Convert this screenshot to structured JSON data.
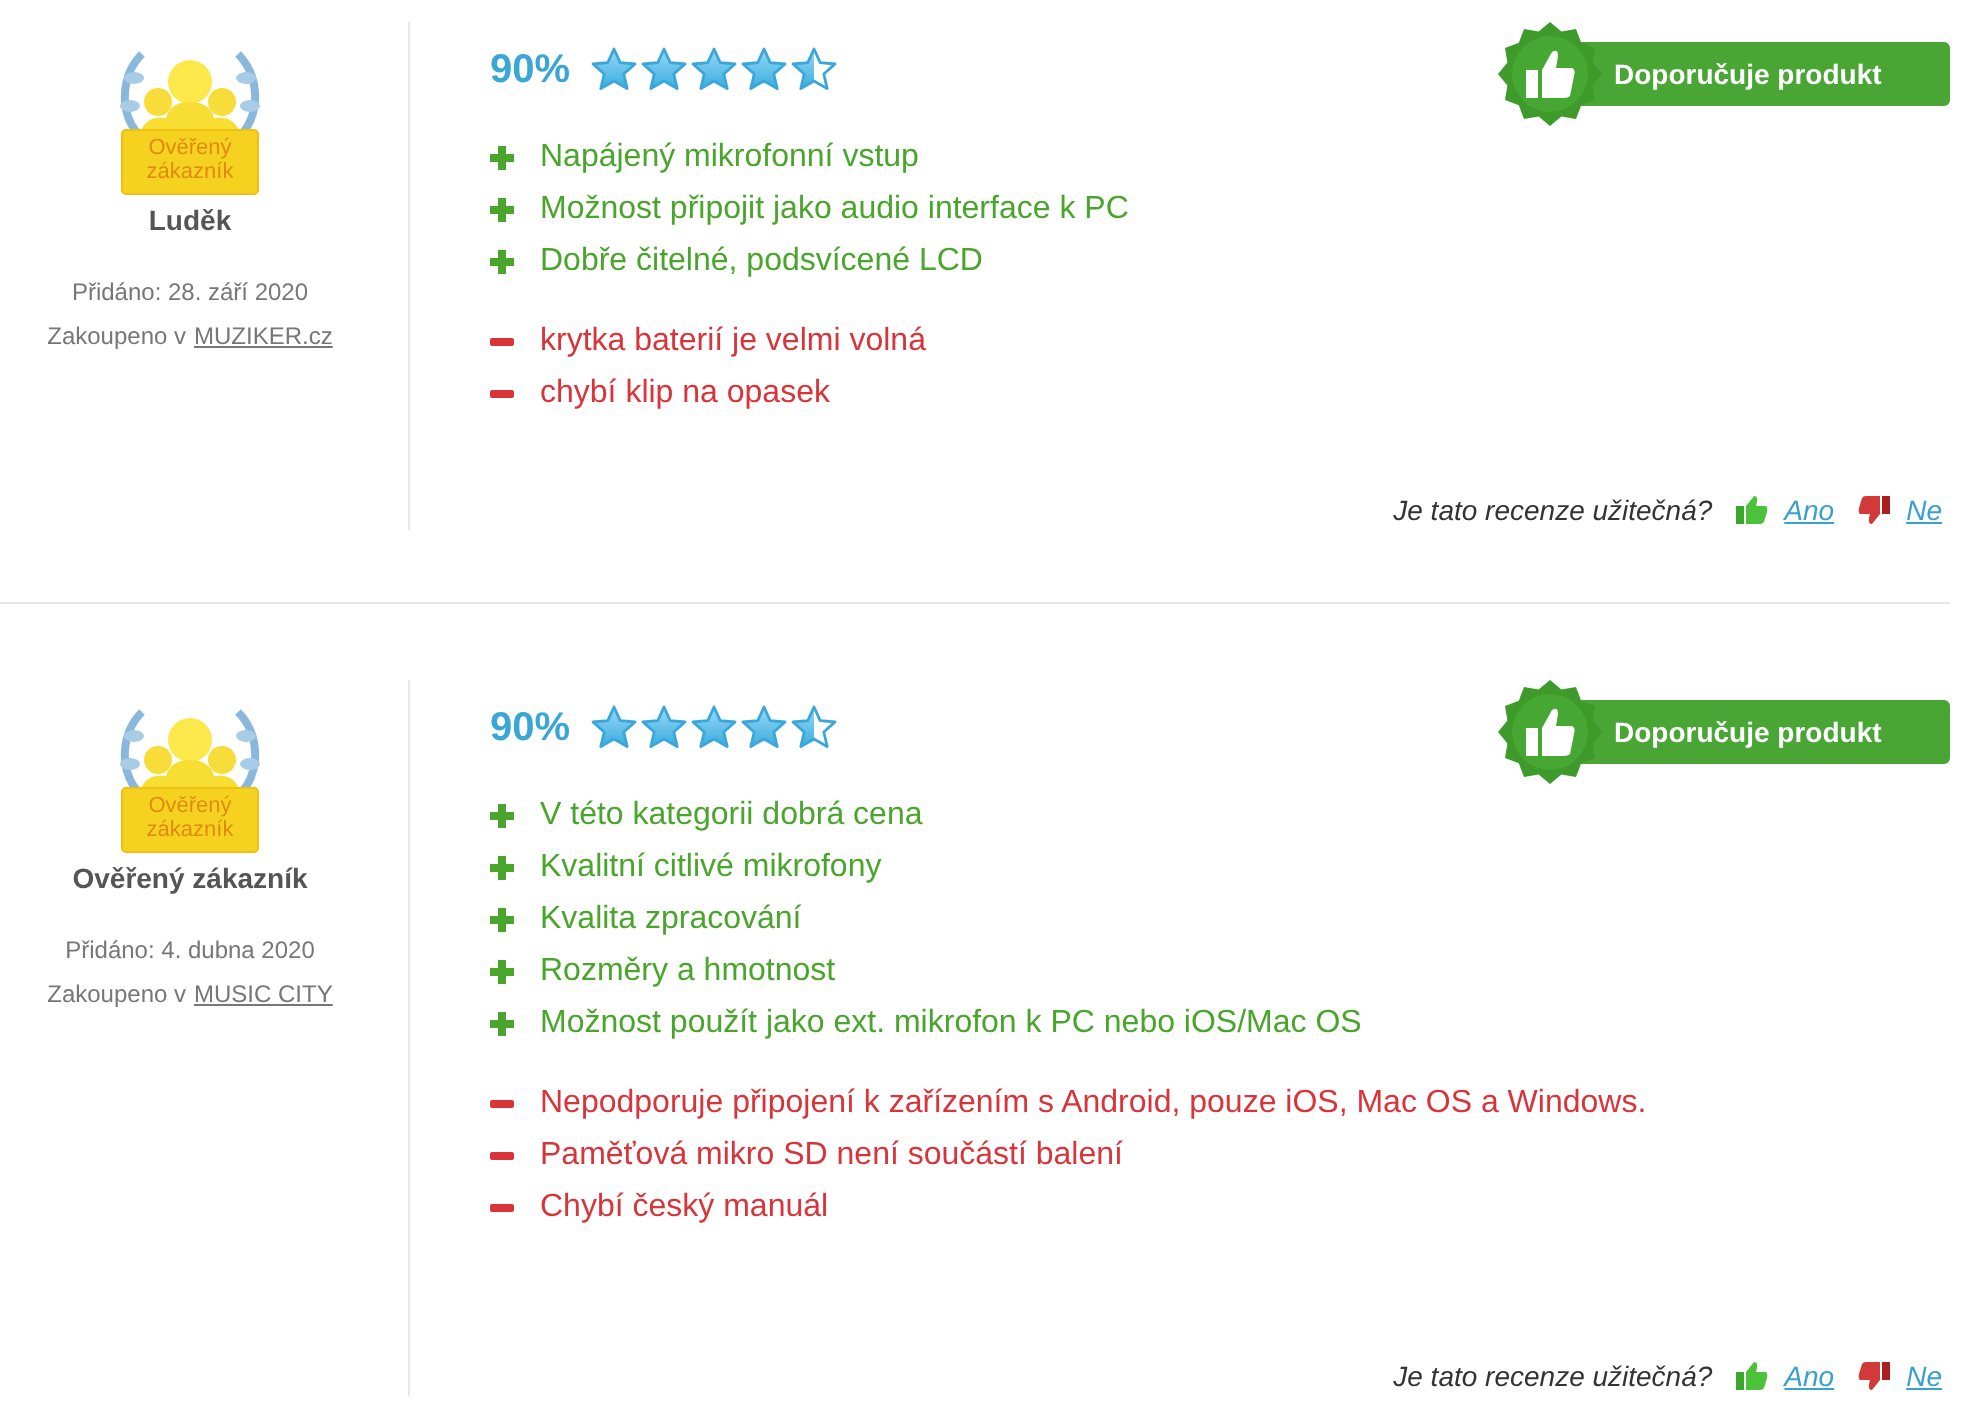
{
  "reviews": [
    {
      "badge_text": "Ověřený zákazník",
      "author": "Luděk",
      "added": "Přidáno: 28. září 2020",
      "purchased_prefix": "Zakoupeno v",
      "shop": "MUZIKER.cz",
      "score": "90%",
      "stars": 4.5,
      "recommend": "Doporučuje produkt",
      "points": [
        {
          "kind": "pro",
          "text": "Napájený mikrofonní vstup"
        },
        {
          "kind": "pro",
          "text": "Možnost připojit jako audio interface k PC"
        },
        {
          "kind": "pro",
          "text": "Dobře čitelné, podsvícené LCD"
        },
        {
          "kind": "con",
          "text": "krytka baterií je velmi volná"
        },
        {
          "kind": "con",
          "text": "chybí klip na opasek"
        }
      ],
      "helpful_question": "Je tato recenze užitečná?",
      "yes": "Ano",
      "no": "Ne"
    },
    {
      "badge_text": "Ověřený zákazník",
      "author": "Ověřený zákazník",
      "added": "Přidáno: 4. dubna 2020",
      "purchased_prefix": "Zakoupeno v",
      "shop": "MUSIC CITY",
      "score": "90%",
      "stars": 4.5,
      "recommend": "Doporučuje produkt",
      "points": [
        {
          "kind": "pro",
          "text": "V této kategorii dobrá cena"
        },
        {
          "kind": "pro",
          "text": "Kvalitní citlivé mikrofony"
        },
        {
          "kind": "pro",
          "text": "Kvalita zpracování"
        },
        {
          "kind": "pro",
          "text": "Rozměry a hmotnost"
        },
        {
          "kind": "pro",
          "text": "Možnost použít jako ext. mikrofon k PC nebo iOS/Mac OS"
        },
        {
          "kind": "con",
          "text": "Nepodporuje připojení k zařízením s Android, pouze iOS, Mac OS a Windows."
        },
        {
          "kind": "con",
          "text": "Paměťová mikro SD není součástí balení"
        },
        {
          "kind": "con",
          "text": "Chybí český manuál"
        }
      ],
      "helpful_question": "Je tato recenze užitečná?",
      "yes": "Ano",
      "no": "Ne"
    }
  ]
}
